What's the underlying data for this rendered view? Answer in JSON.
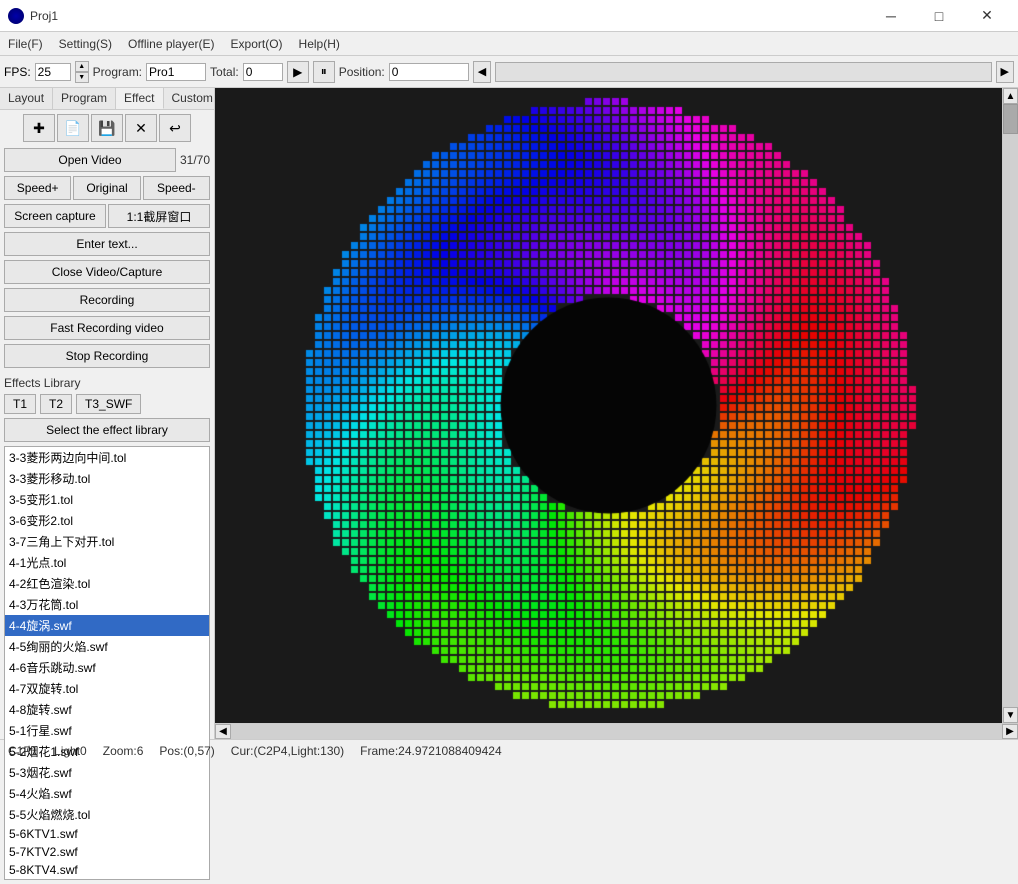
{
  "titlebar": {
    "title": "Proj1",
    "icon": "app-icon",
    "controls": {
      "minimize": "─",
      "maximize": "□",
      "close": "✕"
    }
  },
  "menubar": {
    "items": [
      {
        "label": "File(F)"
      },
      {
        "label": "Setting(S)"
      },
      {
        "label": "Offline player(E)"
      },
      {
        "label": "Export(O)"
      },
      {
        "label": "Help(H)"
      }
    ]
  },
  "toolbar": {
    "fps_label": "FPS:",
    "fps_value": "25",
    "program_label": "Program:",
    "program_value": "Pro1",
    "total_label": "Total:",
    "total_value": "0",
    "position_label": "Position:",
    "position_value": "0",
    "play_icon": "▶",
    "pause_icon": "⏸",
    "prev_icon": "◀",
    "next_icon": "▶"
  },
  "tabs": {
    "layout": "Layout",
    "program": "Program",
    "effect": "Effect",
    "custom": "Custom",
    "nav_left": "◀",
    "nav_right": "▶"
  },
  "controls": {
    "open_video": "Open Video",
    "count": "31/70",
    "speed_plus": "Speed+",
    "original": "Original",
    "speed_minus": "Speed-",
    "screen_capture": "Screen capture",
    "ratio": "1:1截屏窗口",
    "enter_text": "Enter text...",
    "close_video": "Close Video/Capture",
    "recording": "Recording",
    "fast_recording": "Fast Recording video",
    "stop_recording": "Stop Recording",
    "icon_btns": [
      "✚",
      "📄",
      "💾",
      "✕",
      "↩"
    ]
  },
  "effects": {
    "title": "Effects Library",
    "tabs": [
      "T1",
      "T2",
      "T3_SWF"
    ],
    "select_btn": "Select the effect library",
    "items": [
      "3-3菱形两边向中间.tol",
      "3-3菱形移动.tol",
      "3-5变形1.tol",
      "3-6变形2.tol",
      "3-7三角上下对开.tol",
      "4-1光点.tol",
      "4-2红色渲染.tol",
      "4-3万花筒.tol",
      "4-4旋涡.swf",
      "4-5绚丽的火焰.swf",
      "4-6音乐跳动.swf",
      "4-7双旋转.tol",
      "4-8旋转.swf",
      "5-1行星.swf",
      "5-2烟花1.swf",
      "5-3烟花.swf",
      "5-4火焰.swf",
      "5-5火焰燃烧.tol",
      "5-6KTV1.swf",
      "5-7KTV2.swf",
      "5-8KTV4.swf"
    ],
    "selected_index": 8
  },
  "statusbar": {
    "c1p1": "C1P1",
    "light0": "Light0",
    "zoom": "Zoom:6",
    "pos": "Pos:(0,57)",
    "cur": "Cur:(C2P4,Light:130)",
    "frame": "Frame:24.9721088409424"
  }
}
